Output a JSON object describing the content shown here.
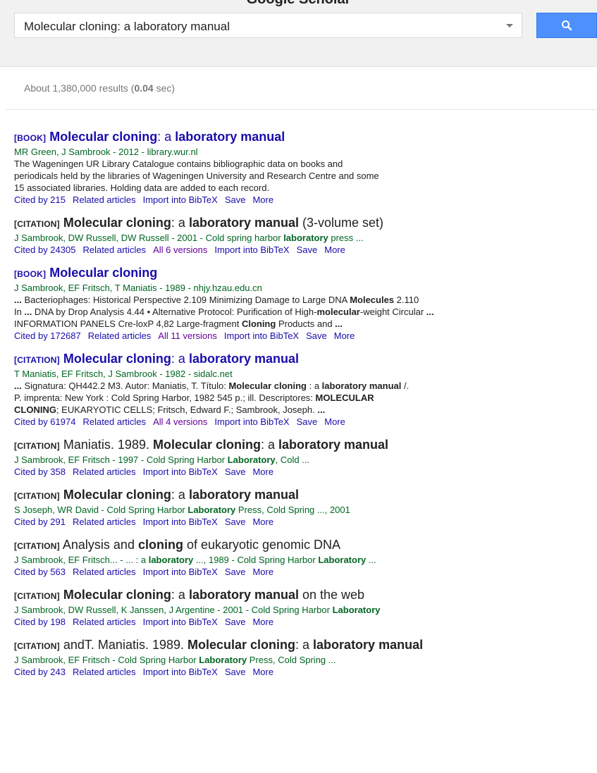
{
  "page": {
    "cut_heading": "Google Scholar"
  },
  "search": {
    "query": "Molecular cloning: a laboratory manual"
  },
  "results_summary": {
    "prefix": "About 1,380,000 results (",
    "time": "0.04",
    "suffix": " sec)"
  },
  "colors": {
    "title_link": "#1a0dab",
    "author_green": "#006621",
    "visited": "#660099",
    "search_button": "#4d90fe"
  },
  "results": [
    {
      "tag": "[BOOK]",
      "linked": true,
      "title": [
        [
          "Molecular cloning",
          true
        ],
        [
          ": a ",
          false
        ],
        [
          "laboratory manual",
          true
        ]
      ],
      "authors": [
        [
          "MR Green, J Sambrook - 2012 - library.wur.nl",
          false
        ]
      ],
      "snippet": [
        [
          [
            "The Wageningen UR Library Catalogue contains bibliographic data on books and",
            false
          ]
        ],
        [
          [
            "periodicals held by the libraries of Wageningen University and Research Centre and some",
            false
          ]
        ],
        [
          [
            "15 associated libraries. Holding data are added to each record.",
            false
          ]
        ]
      ],
      "links": [
        "Cited by 215",
        "Related articles",
        "Import into BibTeX",
        "Save",
        "More"
      ]
    },
    {
      "tag": "[CITATION]",
      "linked": false,
      "title": [
        [
          "Molecular cloning",
          true
        ],
        [
          ": a ",
          false
        ],
        [
          "laboratory manual",
          true
        ],
        [
          " (3-volume set)",
          false
        ]
      ],
      "authors": [
        [
          "J Sambrook, DW Russell, DW Russell - 2001 - Cold spring harbor ",
          false
        ],
        [
          "laboratory",
          true
        ],
        [
          " press ...",
          false
        ]
      ],
      "snippet": [],
      "links": [
        "Cited by 24305",
        "Related articles",
        "All 6 versions",
        "Import into BibTeX",
        "Save",
        "More"
      ]
    },
    {
      "tag": "[BOOK]",
      "linked": true,
      "title": [
        [
          "Molecular cloning",
          true
        ]
      ],
      "authors": [
        [
          "J Sambrook, EF Fritsch, T Maniatis - 1989 - nhjy.hzau.edu.cn",
          false
        ]
      ],
      "snippet": [
        [
          [
            "...",
            true
          ],
          [
            " Bacteriophages: Historical Perspective 2.109 Minimizing Damage to Large DNA ",
            false
          ],
          [
            "Molecules",
            true
          ],
          [
            " 2.110",
            false
          ]
        ],
        [
          [
            "In ",
            false
          ],
          [
            "...",
            true
          ],
          [
            " DNA by Drop Analysis 4.44 • Alternative Protocol: Purification of High-",
            false
          ],
          [
            "molecular",
            true
          ],
          [
            "-weight Circular ",
            false
          ],
          [
            "...",
            true
          ]
        ],
        [
          [
            "INFORMATION PANELS Cre-loxP 4,82 Large-fragment ",
            false
          ],
          [
            "Cloning",
            true
          ],
          [
            " Products and ",
            false
          ],
          [
            "...",
            true
          ]
        ]
      ],
      "links": [
        "Cited by 172687",
        "Related articles",
        "All 11 versions",
        "Import into BibTeX",
        "Save",
        "More"
      ]
    },
    {
      "tag": "[CITATION]",
      "linked": true,
      "title": [
        [
          "Molecular cloning",
          true
        ],
        [
          ": a ",
          false
        ],
        [
          "laboratory manual",
          true
        ]
      ],
      "authors": [
        [
          "T Maniatis, EF Fritsch, J Sambrook - 1982 - sidalc.net",
          false
        ]
      ],
      "snippet": [
        [
          [
            "...",
            true
          ],
          [
            " Signatura: QH442.2 M3. Autor: Maniatis, T. Título: ",
            false
          ],
          [
            "Molecular cloning",
            true
          ],
          [
            " : a ",
            false
          ],
          [
            "laboratory manual",
            true
          ],
          [
            " /.",
            false
          ]
        ],
        [
          [
            "P. imprenta: New York : Cold Spring Harbor, 1982 545 p.; ill. Descriptores: ",
            false
          ],
          [
            "MOLECULAR",
            true
          ]
        ],
        [
          [
            "CLONING",
            true
          ],
          [
            "; EUKARYOTIC CELLS; Fritsch, Edward F.; Sambrook, Joseph. ",
            false
          ],
          [
            "...",
            true
          ]
        ]
      ],
      "links": [
        "Cited by 61974",
        "Related articles",
        "All 4 versions",
        "Import into BibTeX",
        "Save",
        "More"
      ]
    },
    {
      "tag": "[CITATION]",
      "linked": false,
      "title": [
        [
          "Maniatis. 1989. ",
          false
        ],
        [
          "Molecular cloning",
          true
        ],
        [
          ": a ",
          false
        ],
        [
          "laboratory manual",
          true
        ]
      ],
      "authors": [
        [
          "J Sambrook, EF Fritsch - 1997 - Cold Spring Harbor ",
          false
        ],
        [
          "Laboratory",
          true
        ],
        [
          ", Cold ...",
          false
        ]
      ],
      "snippet": [],
      "links": [
        "Cited by 358",
        "Related articles",
        "Import into BibTeX",
        "Save",
        "More"
      ]
    },
    {
      "tag": "[CITATION]",
      "linked": false,
      "title": [
        [
          "Molecular cloning",
          true
        ],
        [
          ": a ",
          false
        ],
        [
          "laboratory manual",
          true
        ]
      ],
      "authors": [
        [
          "S Joseph, WR David - Cold Spring Harbor ",
          false
        ],
        [
          "Laboratory",
          true
        ],
        [
          " Press, Cold Spring ..., 2001",
          false
        ]
      ],
      "snippet": [],
      "links": [
        "Cited by 291",
        "Related articles",
        "Import into BibTeX",
        "Save",
        "More"
      ]
    },
    {
      "tag": "[CITATION]",
      "linked": false,
      "title": [
        [
          "Analysis and ",
          false
        ],
        [
          "cloning",
          true
        ],
        [
          " of eukaryotic genomic DNA",
          false
        ]
      ],
      "authors": [
        [
          "J Sambrook, EF Fritsch... - ... : a ",
          false
        ],
        [
          "laboratory",
          true
        ],
        [
          " ..., 1989 - Cold Spring Harbor ",
          false
        ],
        [
          "Laboratory",
          true
        ],
        [
          " ...",
          false
        ]
      ],
      "snippet": [],
      "links": [
        "Cited by 563",
        "Related articles",
        "Import into BibTeX",
        "Save",
        "More"
      ]
    },
    {
      "tag": "[CITATION]",
      "linked": false,
      "title": [
        [
          "Molecular cloning",
          true
        ],
        [
          ": a ",
          false
        ],
        [
          "laboratory manual",
          true
        ],
        [
          " on the web",
          false
        ]
      ],
      "authors": [
        [
          "J Sambrook, DW Russell, K Janssen, J Argentine - 2001 - Cold Spring Harbor ",
          false
        ],
        [
          "Laboratory",
          true
        ]
      ],
      "snippet": [],
      "links": [
        "Cited by 198",
        "Related articles",
        "Import into BibTeX",
        "Save",
        "More"
      ]
    },
    {
      "tag": "[CITATION]",
      "linked": false,
      "title": [
        [
          "andT. Maniatis. 1989. ",
          false
        ],
        [
          "Molecular cloning",
          true
        ],
        [
          ": a ",
          false
        ],
        [
          "laboratory manual",
          true
        ]
      ],
      "authors": [
        [
          "J Sambrook, EF Fritsch - Cold Spring Harbor ",
          false
        ],
        [
          "Laboratory",
          true
        ],
        [
          " Press, Cold Spring ...",
          false
        ]
      ],
      "snippet": [],
      "links": [
        "Cited by 243",
        "Related articles",
        "Import into BibTeX",
        "Save",
        "More"
      ]
    }
  ]
}
